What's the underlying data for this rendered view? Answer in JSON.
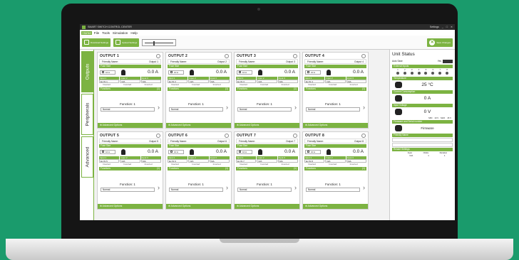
{
  "window": {
    "title": "SMART SWITCH CONTROL CENTER",
    "account": "Settings"
  },
  "menu": [
    "Home",
    "File",
    "Tools",
    "Simulation",
    "Help"
  ],
  "toolbar": {
    "download": "Download Settings",
    "upload": "Upload Settings",
    "save": "Save Changes"
  },
  "tabs": [
    "Outputs",
    "Peripherals",
    "Advanced"
  ],
  "labels": {
    "friendly_name": "Friendly Name:",
    "fuse_size": "Fuse Size",
    "functions": "Functions",
    "functions_count": "(1)",
    "inverted": "Inverted",
    "advanced_options": "⊕ Advanced Options"
  },
  "outputs": [
    {
      "title": "OUTPUT  1",
      "name": "Output 1",
      "fuse": "10 A",
      "current": "0.0 A",
      "inputs": [
        "Input 1",
        "Input 2",
        "Input 3"
      ],
      "input_values": [
        "Ex IN 1",
        "N/A",
        "N/A"
      ],
      "function": "Function: 1",
      "mode": "Normal"
    },
    {
      "title": "OUTPUT  2",
      "name": "Output 2",
      "fuse": "10 A",
      "current": "0.0 A",
      "inputs": [
        "Input 1",
        "Input 2",
        "Input 3"
      ],
      "input_values": [
        "Ex IN 2",
        "N/A",
        "N/A"
      ],
      "function": "Function: 1",
      "mode": "Normal"
    },
    {
      "title": "OUTPUT  3",
      "name": "Output 3",
      "fuse": "10 A",
      "current": "0.0 A",
      "inputs": [
        "Input 1",
        "Input 2",
        "Input 3"
      ],
      "input_values": [
        "Ex IN 3",
        "N/A",
        "N/A"
      ],
      "function": "Function: 1",
      "mode": "Normal"
    },
    {
      "title": "OUTPUT  4",
      "name": "Output 4",
      "fuse": "10 A",
      "current": "0.0 A",
      "inputs": [
        "Input 1",
        "Input 2",
        "Input 3"
      ],
      "input_values": [
        "Ex IN 4",
        "N/A",
        "N/A"
      ],
      "function": "Function: 1",
      "mode": "Normal"
    },
    {
      "title": "OUTPUT  5",
      "name": "Output 5",
      "fuse": "10 A",
      "current": "0.0 A",
      "inputs": [
        "Input 1",
        "Input 2",
        "Input 3"
      ],
      "input_values": [
        "Ex IN 5",
        "N/A",
        "N/A"
      ],
      "function": "Function: 1",
      "mode": "Normal"
    },
    {
      "title": "OUTPUT  6",
      "name": "Output 6",
      "fuse": "10 A",
      "current": "0.0 A",
      "inputs": [
        "Input 1",
        "Input 2",
        "Input 3"
      ],
      "input_values": [
        "Ex IN 6",
        "N/A",
        "N/A"
      ],
      "function": "Function: 1",
      "mode": "Normal"
    },
    {
      "title": "OUTPUT  7",
      "name": "Output 7",
      "fuse": "10 A",
      "current": "0.0 A",
      "inputs": [
        "Input 1",
        "Input 2",
        "Input 3"
      ],
      "input_values": [
        "Ex IN 7",
        "N/A",
        "N/A"
      ],
      "function": "Function: 1",
      "mode": "Normal"
    },
    {
      "title": "OUTPUT  8",
      "name": "Output 8",
      "fuse": "10 A",
      "current": "0.0 A",
      "inputs": [
        "Input 1",
        "Input 2",
        "Input 3"
      ],
      "input_values": [
        "Ex IN 8",
        "N/A",
        "N/A"
      ],
      "function": "Function: 1",
      "mode": "Normal"
    }
  ],
  "status": {
    "title": "Unit Status",
    "auto_save": "Auto Save",
    "auto_save_value": "Yes",
    "external_inputs": "External Inputs",
    "input_numbers": [
      "1",
      "2",
      "3",
      "4",
      "5",
      "6",
      "7",
      "8"
    ],
    "temperature": "Temperature",
    "temperature_value": "25 °C",
    "current": "Current Consumption",
    "current_value": "0 A",
    "voltage": "Input Voltage",
    "voltage_value": "0 V",
    "min": "MIN",
    "min_value": "10 V",
    "max": "MAX",
    "max_value": "15 V",
    "firmware": "Firmware and Serial number",
    "firmware_value": "Firmware",
    "friendly": "Friendly Name",
    "restart": "Restart Settings",
    "restart_cols": [
      "Input",
      "Clicks",
      "Duration"
    ],
    "restart_vals": [
      "N/A",
      "1",
      "1"
    ]
  }
}
